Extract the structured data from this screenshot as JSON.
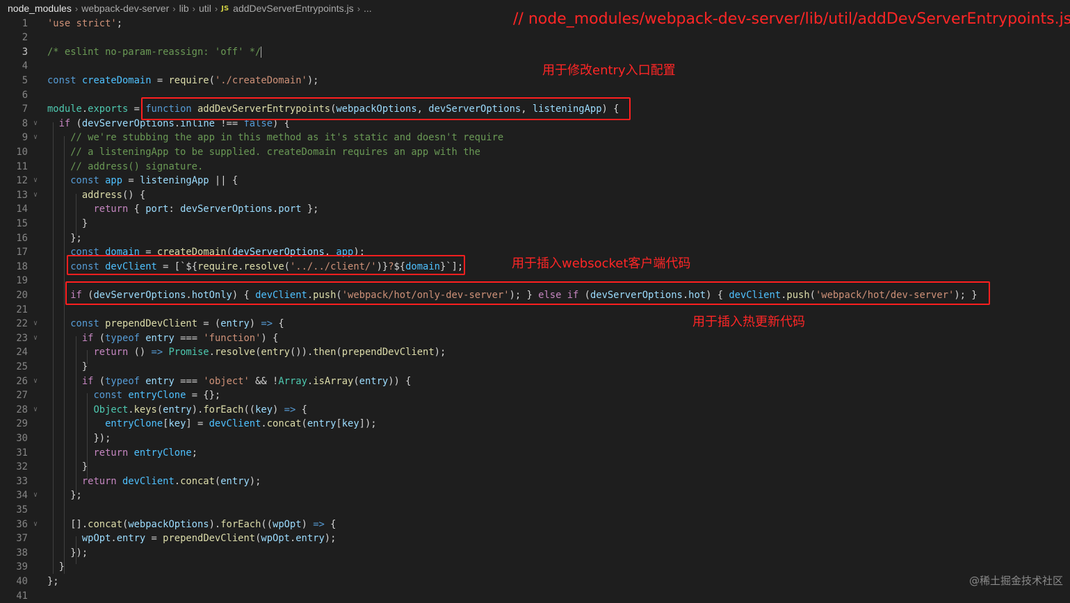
{
  "breadcrumb": {
    "items": [
      "node_modules",
      "webpack-dev-server",
      "lib",
      "util",
      "addDevServerEntrypoints.js"
    ],
    "file_icon": "JS",
    "ellipsis": "..."
  },
  "editor": {
    "active_line": 3,
    "lines": [
      {
        "n": "1",
        "tokens": [
          [
            "str",
            "'use strict'"
          ],
          [
            "punc",
            ";"
          ]
        ]
      },
      {
        "n": "2",
        "tokens": []
      },
      {
        "n": "3",
        "tokens": [
          [
            "cm",
            "/* eslint no-param-reassign: 'off' */"
          ]
        ],
        "cursor": true
      },
      {
        "n": "4",
        "tokens": []
      },
      {
        "n": "5",
        "tokens": [
          [
            "kw",
            "const"
          ],
          [
            "punc",
            " "
          ],
          [
            "cst",
            "createDomain"
          ],
          [
            "punc",
            " = "
          ],
          [
            "fn",
            "require"
          ],
          [
            "punc",
            "("
          ],
          [
            "str",
            "'./createDomain'"
          ],
          [
            "punc",
            ");"
          ]
        ]
      },
      {
        "n": "6",
        "tokens": []
      },
      {
        "n": "7",
        "tokens": [
          [
            "cls",
            "module"
          ],
          [
            "punc",
            "."
          ],
          [
            "cls",
            "exports"
          ],
          [
            "punc",
            " = "
          ],
          [
            "kw",
            "function"
          ],
          [
            "punc",
            " "
          ],
          [
            "fn",
            "addDevServerEntrypoints"
          ],
          [
            "punc",
            "("
          ],
          [
            "var",
            "webpackOptions"
          ],
          [
            "punc",
            ", "
          ],
          [
            "var",
            "devServerOptions"
          ],
          [
            "punc",
            ", "
          ],
          [
            "var",
            "listeningApp"
          ],
          [
            "punc",
            ") {"
          ]
        ]
      },
      {
        "n": "8",
        "fold": true,
        "tokens": [
          [
            "punc",
            "  "
          ],
          [
            "ctl",
            "if"
          ],
          [
            "punc",
            " ("
          ],
          [
            "var",
            "devServerOptions"
          ],
          [
            "punc",
            "."
          ],
          [
            "var",
            "inline"
          ],
          [
            "punc",
            " !== "
          ],
          [
            "kw",
            "false"
          ],
          [
            "punc",
            ") {"
          ]
        ]
      },
      {
        "n": "9",
        "fold": true,
        "tokens": [
          [
            "punc",
            "    "
          ],
          [
            "cm",
            "// we're stubbing the app in this method as it's static and doesn't require"
          ]
        ]
      },
      {
        "n": "10",
        "tokens": [
          [
            "punc",
            "    "
          ],
          [
            "cm",
            "// a listeningApp to be supplied. createDomain requires an app with the"
          ]
        ]
      },
      {
        "n": "11",
        "tokens": [
          [
            "punc",
            "    "
          ],
          [
            "cm",
            "// address() signature."
          ]
        ]
      },
      {
        "n": "12",
        "fold": true,
        "tokens": [
          [
            "punc",
            "    "
          ],
          [
            "kw",
            "const"
          ],
          [
            "punc",
            " "
          ],
          [
            "cst",
            "app"
          ],
          [
            "punc",
            " = "
          ],
          [
            "var",
            "listeningApp"
          ],
          [
            "punc",
            " || {"
          ]
        ]
      },
      {
        "n": "13",
        "fold": true,
        "tokens": [
          [
            "punc",
            "      "
          ],
          [
            "fn",
            "address"
          ],
          [
            "punc",
            "() {"
          ]
        ]
      },
      {
        "n": "14",
        "tokens": [
          [
            "punc",
            "        "
          ],
          [
            "ctl",
            "return"
          ],
          [
            "punc",
            " { "
          ],
          [
            "var",
            "port"
          ],
          [
            "punc",
            ": "
          ],
          [
            "var",
            "devServerOptions"
          ],
          [
            "punc",
            "."
          ],
          [
            "var",
            "port"
          ],
          [
            "punc",
            " };"
          ]
        ]
      },
      {
        "n": "15",
        "tokens": [
          [
            "punc",
            "      }"
          ]
        ]
      },
      {
        "n": "16",
        "tokens": [
          [
            "punc",
            "    };"
          ]
        ]
      },
      {
        "n": "17",
        "tokens": [
          [
            "punc",
            "    "
          ],
          [
            "kw",
            "const"
          ],
          [
            "punc",
            " "
          ],
          [
            "cst",
            "domain"
          ],
          [
            "punc",
            " = "
          ],
          [
            "fn",
            "createDomain"
          ],
          [
            "punc",
            "("
          ],
          [
            "var",
            "devServerOptions"
          ],
          [
            "punc",
            ", "
          ],
          [
            "cst",
            "app"
          ],
          [
            "punc",
            ");"
          ]
        ]
      },
      {
        "n": "18",
        "tokens": [
          [
            "punc",
            "    "
          ],
          [
            "kw",
            "const"
          ],
          [
            "punc",
            " "
          ],
          [
            "cst",
            "devClient"
          ],
          [
            "punc",
            " = [`${"
          ],
          [
            "fn",
            "require"
          ],
          [
            "punc",
            "."
          ],
          [
            "fn",
            "resolve"
          ],
          [
            "punc",
            "("
          ],
          [
            "str",
            "'../../client/'"
          ],
          [
            "punc",
            ")}"
          ],
          [
            "str",
            "?"
          ],
          [
            "punc",
            "${"
          ],
          [
            "cst",
            "domain"
          ],
          [
            "punc",
            "}`];"
          ]
        ]
      },
      {
        "n": "19",
        "tokens": []
      },
      {
        "n": "20",
        "tokens": [
          [
            "punc",
            "    "
          ],
          [
            "ctl",
            "if"
          ],
          [
            "punc",
            " ("
          ],
          [
            "var",
            "devServerOptions"
          ],
          [
            "punc",
            "."
          ],
          [
            "var",
            "hotOnly"
          ],
          [
            "punc",
            ") { "
          ],
          [
            "cst",
            "devClient"
          ],
          [
            "punc",
            "."
          ],
          [
            "fn",
            "push"
          ],
          [
            "punc",
            "("
          ],
          [
            "str",
            "'webpack/hot/only-dev-server'"
          ],
          [
            "punc",
            "); } "
          ],
          [
            "ctl",
            "else"
          ],
          [
            "punc",
            " "
          ],
          [
            "ctl",
            "if"
          ],
          [
            "punc",
            " ("
          ],
          [
            "var",
            "devServerOptions"
          ],
          [
            "punc",
            "."
          ],
          [
            "var",
            "hot"
          ],
          [
            "punc",
            ") { "
          ],
          [
            "cst",
            "devClient"
          ],
          [
            "punc",
            "."
          ],
          [
            "fn",
            "push"
          ],
          [
            "punc",
            "("
          ],
          [
            "str",
            "'webpack/hot/dev-server'"
          ],
          [
            "punc",
            "); }"
          ]
        ]
      },
      {
        "n": "21",
        "tokens": []
      },
      {
        "n": "22",
        "fold": true,
        "tokens": [
          [
            "punc",
            "    "
          ],
          [
            "kw",
            "const"
          ],
          [
            "punc",
            " "
          ],
          [
            "fn",
            "prependDevClient"
          ],
          [
            "punc",
            " = ("
          ],
          [
            "var",
            "entry"
          ],
          [
            "punc",
            ") "
          ],
          [
            "kw",
            "=>"
          ],
          [
            "punc",
            " {"
          ]
        ]
      },
      {
        "n": "23",
        "fold": true,
        "tokens": [
          [
            "punc",
            "      "
          ],
          [
            "ctl",
            "if"
          ],
          [
            "punc",
            " ("
          ],
          [
            "kw",
            "typeof"
          ],
          [
            "punc",
            " "
          ],
          [
            "var",
            "entry"
          ],
          [
            "punc",
            " === "
          ],
          [
            "str",
            "'function'"
          ],
          [
            "punc",
            ") {"
          ]
        ]
      },
      {
        "n": "24",
        "tokens": [
          [
            "punc",
            "        "
          ],
          [
            "ctl",
            "return"
          ],
          [
            "punc",
            " () "
          ],
          [
            "kw",
            "=>"
          ],
          [
            "punc",
            " "
          ],
          [
            "cls",
            "Promise"
          ],
          [
            "punc",
            "."
          ],
          [
            "fn",
            "resolve"
          ],
          [
            "punc",
            "("
          ],
          [
            "fn",
            "entry"
          ],
          [
            "punc",
            "())."
          ],
          [
            "fn",
            "then"
          ],
          [
            "punc",
            "("
          ],
          [
            "fn",
            "prependDevClient"
          ],
          [
            "punc",
            ");"
          ]
        ]
      },
      {
        "n": "25",
        "tokens": [
          [
            "punc",
            "      }"
          ]
        ]
      },
      {
        "n": "26",
        "fold": true,
        "tokens": [
          [
            "punc",
            "      "
          ],
          [
            "ctl",
            "if"
          ],
          [
            "punc",
            " ("
          ],
          [
            "kw",
            "typeof"
          ],
          [
            "punc",
            " "
          ],
          [
            "var",
            "entry"
          ],
          [
            "punc",
            " === "
          ],
          [
            "str",
            "'object'"
          ],
          [
            "punc",
            " && !"
          ],
          [
            "cls",
            "Array"
          ],
          [
            "punc",
            "."
          ],
          [
            "fn",
            "isArray"
          ],
          [
            "punc",
            "("
          ],
          [
            "var",
            "entry"
          ],
          [
            "punc",
            ")) {"
          ]
        ]
      },
      {
        "n": "27",
        "tokens": [
          [
            "punc",
            "        "
          ],
          [
            "kw",
            "const"
          ],
          [
            "punc",
            " "
          ],
          [
            "cst",
            "entryClone"
          ],
          [
            "punc",
            " = {};"
          ]
        ]
      },
      {
        "n": "28",
        "fold": true,
        "tokens": [
          [
            "punc",
            "        "
          ],
          [
            "cls",
            "Object"
          ],
          [
            "punc",
            "."
          ],
          [
            "fn",
            "keys"
          ],
          [
            "punc",
            "("
          ],
          [
            "var",
            "entry"
          ],
          [
            "punc",
            ")."
          ],
          [
            "fn",
            "forEach"
          ],
          [
            "punc",
            "(("
          ],
          [
            "var",
            "key"
          ],
          [
            "punc",
            ") "
          ],
          [
            "kw",
            "=>"
          ],
          [
            "punc",
            " {"
          ]
        ]
      },
      {
        "n": "29",
        "tokens": [
          [
            "punc",
            "          "
          ],
          [
            "cst",
            "entryClone"
          ],
          [
            "punc",
            "["
          ],
          [
            "var",
            "key"
          ],
          [
            "punc",
            "] = "
          ],
          [
            "cst",
            "devClient"
          ],
          [
            "punc",
            "."
          ],
          [
            "fn",
            "concat"
          ],
          [
            "punc",
            "("
          ],
          [
            "var",
            "entry"
          ],
          [
            "punc",
            "["
          ],
          [
            "var",
            "key"
          ],
          [
            "punc",
            "]);"
          ]
        ]
      },
      {
        "n": "30",
        "tokens": [
          [
            "punc",
            "        });"
          ]
        ]
      },
      {
        "n": "31",
        "tokens": [
          [
            "punc",
            "        "
          ],
          [
            "ctl",
            "return"
          ],
          [
            "punc",
            " "
          ],
          [
            "cst",
            "entryClone"
          ],
          [
            "punc",
            ";"
          ]
        ]
      },
      {
        "n": "32",
        "tokens": [
          [
            "punc",
            "      }"
          ]
        ]
      },
      {
        "n": "33",
        "tokens": [
          [
            "punc",
            "      "
          ],
          [
            "ctl",
            "return"
          ],
          [
            "punc",
            " "
          ],
          [
            "cst",
            "devClient"
          ],
          [
            "punc",
            "."
          ],
          [
            "fn",
            "concat"
          ],
          [
            "punc",
            "("
          ],
          [
            "var",
            "entry"
          ],
          [
            "punc",
            ");"
          ]
        ]
      },
      {
        "n": "34",
        "fold": true,
        "tokens": [
          [
            "punc",
            "    };"
          ]
        ]
      },
      {
        "n": "35",
        "tokens": []
      },
      {
        "n": "36",
        "fold": true,
        "tokens": [
          [
            "punc",
            "    []."
          ],
          [
            "fn",
            "concat"
          ],
          [
            "punc",
            "("
          ],
          [
            "var",
            "webpackOptions"
          ],
          [
            "punc",
            ")."
          ],
          [
            "fn",
            "forEach"
          ],
          [
            "punc",
            "(("
          ],
          [
            "var",
            "wpOpt"
          ],
          [
            "punc",
            ") "
          ],
          [
            "kw",
            "=>"
          ],
          [
            "punc",
            " {"
          ]
        ]
      },
      {
        "n": "37",
        "tokens": [
          [
            "punc",
            "      "
          ],
          [
            "var",
            "wpOpt"
          ],
          [
            "punc",
            "."
          ],
          [
            "var",
            "entry"
          ],
          [
            "punc",
            " = "
          ],
          [
            "fn",
            "prependDevClient"
          ],
          [
            "punc",
            "("
          ],
          [
            "var",
            "wpOpt"
          ],
          [
            "punc",
            "."
          ],
          [
            "var",
            "entry"
          ],
          [
            "punc",
            ");"
          ]
        ]
      },
      {
        "n": "38",
        "tokens": [
          [
            "punc",
            "    });"
          ]
        ]
      },
      {
        "n": "39",
        "tokens": [
          [
            "punc",
            "  }"
          ]
        ]
      },
      {
        "n": "40",
        "tokens": [
          [
            "punc",
            "};"
          ]
        ]
      },
      {
        "n": "41",
        "tokens": []
      }
    ]
  },
  "annotations": {
    "file_path": "// node_modules/webpack-dev-server/lib/util/addDevServerEntrypoints.js",
    "entry_note": "用于修改entry入口配置",
    "websocket_note": "用于插入websocket客户端代码",
    "hot_note": "用于插入热更新代码"
  },
  "colors": {
    "annotation": "#ff1f1f",
    "background": "#1e1e1e"
  },
  "watermark": "@稀土掘金技术社区"
}
